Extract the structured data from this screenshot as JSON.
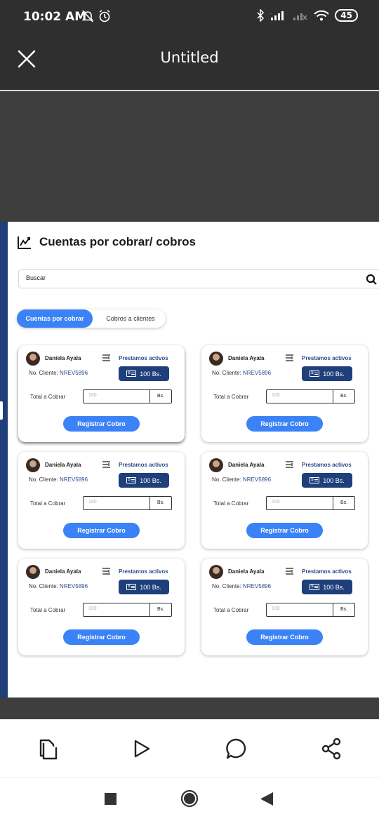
{
  "status_bar": {
    "time": "10:02 AM",
    "battery": "45",
    "icons": [
      "mute-bell-icon",
      "alarm-icon",
      "bluetooth-icon",
      "signal-icon",
      "signal-off-icon",
      "wifi-icon",
      "battery-icon"
    ]
  },
  "app_bar": {
    "title": "Untitled",
    "close_icon": "close-icon"
  },
  "page": {
    "title": "Cuentas por cobrar/ cobros",
    "title_icon": "chart-trend-icon",
    "search_placeholder": "Buscar",
    "tabs": [
      {
        "label": "Cuentas por cobrar",
        "active": true
      },
      {
        "label": "Cobros a clientes",
        "active": false
      }
    ]
  },
  "cards": [
    {
      "name": "Daniela Ayala",
      "link": "Prestamos activos",
      "cliente_label": "No. Cliente:",
      "cliente_code": "NREV5896",
      "amount": "100 Bs.",
      "total_label": "Total a Cobrar",
      "input_placeholder": "100",
      "unit": "Bs.",
      "button": "Registrar Cobro"
    },
    {
      "name": "Daniela Ayala",
      "link": "Prestamos activos",
      "cliente_label": "No. Cliente:",
      "cliente_code": "NREV5896",
      "amount": "100 Bs.",
      "total_label": "Total a Cobrar",
      "input_placeholder": "100",
      "unit": "Bs.",
      "button": "Registrar Cobro"
    },
    {
      "name": "Daniela Ayala",
      "link": "Prestamos activos",
      "cliente_label": "No. Cliente:",
      "cliente_code": "NREV5896",
      "amount": "100 Bs.",
      "total_label": "Total a Cobrar",
      "input_placeholder": "100",
      "unit": "Bs.",
      "button": "Registrar Cobro"
    },
    {
      "name": "Daniela Ayala",
      "link": "Prestamos activos",
      "cliente_label": "No. Cliente:",
      "cliente_code": "NREV5896",
      "amount": "100 Bs.",
      "total_label": "Total a Cobrar",
      "input_placeholder": "100",
      "unit": "Bs.",
      "button": "Registrar Cobro"
    },
    {
      "name": "Daniela Ayala",
      "link": "Prestamos activos",
      "cliente_label": "No. Cliente:",
      "cliente_code": "NREV5896",
      "amount": "100 Bs.",
      "total_label": "Total a Cobrar",
      "input_placeholder": "100",
      "unit": "Bs.",
      "button": "Registrar Cobro"
    },
    {
      "name": "Daniela Ayala",
      "link": "Prestamos activos",
      "cliente_label": "No. Cliente:",
      "cliente_code": "NREV5896",
      "amount": "100 Bs.",
      "total_label": "Total a Cobrar",
      "input_placeholder": "100",
      "unit": "Bs.",
      "button": "Registrar Cobro"
    }
  ],
  "toolbar": {
    "icons": [
      "document-copy-icon",
      "play-icon",
      "comment-icon",
      "share-icon"
    ]
  },
  "nav_bar": {
    "icons": [
      "recents-square-icon",
      "home-circle-icon",
      "back-triangle-icon"
    ]
  },
  "colors": {
    "primary_blue": "#3b82f6",
    "navy": "#1f3f7a",
    "link_blue": "#2b4c8c",
    "dark_chrome": "#2f2f2f"
  }
}
